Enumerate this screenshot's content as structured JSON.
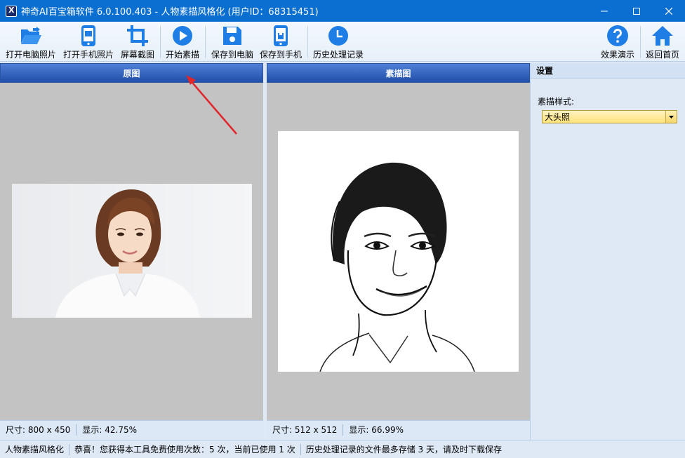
{
  "window": {
    "title": "神奇AI百宝箱软件 6.0.100.403 - 人物素描风格化 (用户ID：68315451)"
  },
  "toolbar": {
    "open_pc": "打开电脑照片",
    "open_phone": "打开手机照片",
    "screenshot": "屏幕截图",
    "start": "开始素描",
    "save_pc": "保存到电脑",
    "save_phone": "保存到手机",
    "history": "历史处理记录",
    "demo": "效果演示",
    "home": "返回首页"
  },
  "original": {
    "header": "原图",
    "size": "尺寸: 800 x 450",
    "zoom": "显示: 42.75%"
  },
  "sketch": {
    "header": "素描图",
    "size": "尺寸: 512 x 512",
    "zoom": "显示: 66.99%"
  },
  "settings": {
    "title": "设置",
    "style_label": "素描样式:",
    "style_value": "大头照"
  },
  "statusbar": {
    "module": "人物素描风格化",
    "usage": "恭喜！您获得本工具免费使用次数：5 次，当前已使用 1 次",
    "notice": "历史处理记录的文件最多存储 3 天，请及时下载保存"
  },
  "colors": {
    "titlebar": "#0a6fd1",
    "icon_blue": "#1e7ee6",
    "header_top": "#4f7fd6",
    "header_bottom": "#1f4fa8",
    "arrow": "#e0262b"
  }
}
